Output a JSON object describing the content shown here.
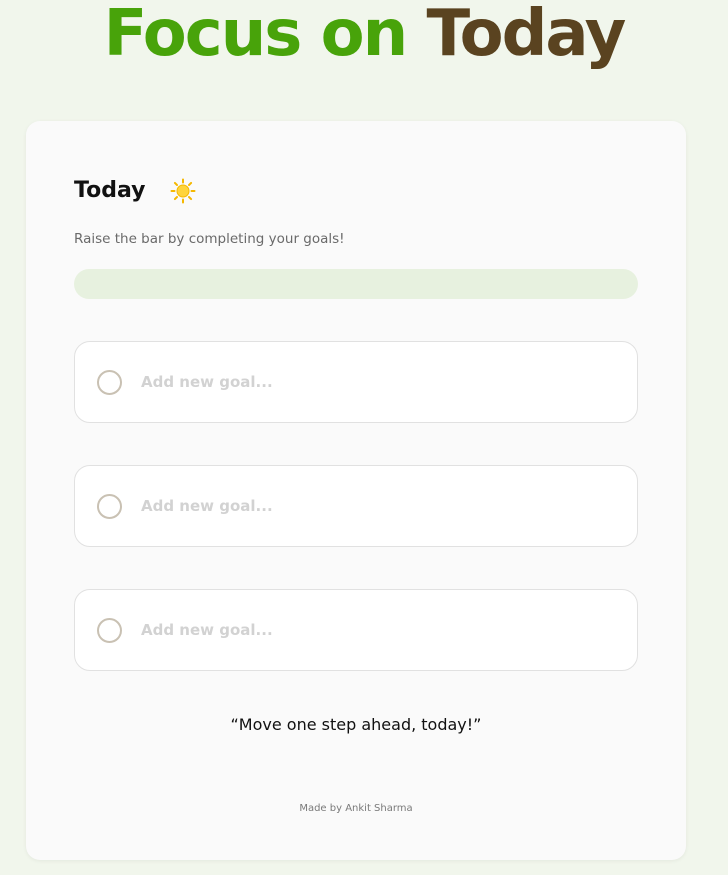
{
  "header": {
    "title_word_1": "Focus on",
    "title_word_2": "Today",
    "colors": {
      "word_1": "#48a30a",
      "word_2": "#5a4320"
    }
  },
  "card": {
    "title": "Today",
    "title_icon": "sun-icon",
    "subtitle": "Raise the bar by completing your goals!",
    "progress": {
      "completed": 0,
      "total": 3,
      "fraction": 0
    },
    "goals": [
      {
        "value": "",
        "placeholder": "Add new goal...",
        "completed": false
      },
      {
        "value": "",
        "placeholder": "Add new goal...",
        "completed": false
      },
      {
        "value": "",
        "placeholder": "Add new goal...",
        "completed": false
      }
    ],
    "quote": "“Move one step ahead, today!”",
    "credit": "Made by Ankit Sharma"
  },
  "colors": {
    "background": "#f1f6ec",
    "card": "#fafafa",
    "progress_track": "#e7f1df",
    "accent": "#48a30a"
  }
}
